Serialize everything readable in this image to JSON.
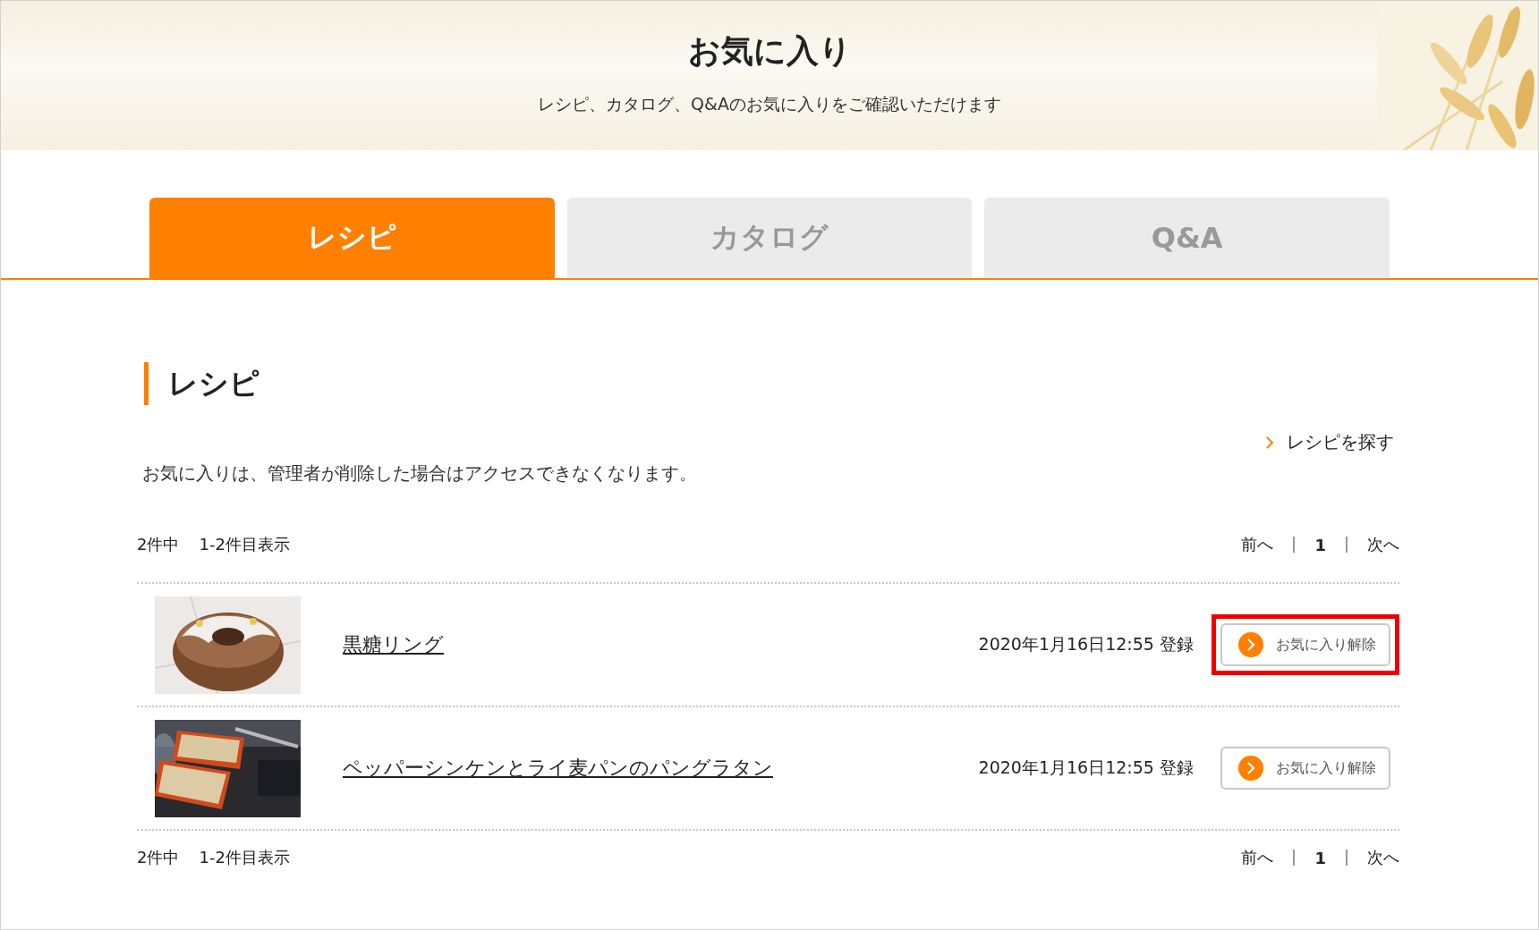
{
  "header": {
    "title": "お気に入り",
    "subtitle": "レシピ、カタログ、Q&Aのお気に入りをご確認いただけます"
  },
  "tabs": [
    {
      "label": "レシピ",
      "selected": true
    },
    {
      "label": "カタログ",
      "selected": false
    },
    {
      "label": "Q&A",
      "selected": false
    }
  ],
  "section": {
    "heading": "レシピ",
    "search_link": "レシピを探す",
    "note": "お気に入りは、管理者が削除した場合はアクセスできなくなります。"
  },
  "pagination_top": {
    "count": "2件中",
    "range": "1-2件目表示",
    "prev": "前へ",
    "page": "1",
    "next": "次へ"
  },
  "items": [
    {
      "title": "黒糖リング",
      "date": "2020年1月16日12:55 登録",
      "button": "お気に入り解除",
      "highlighted": true
    },
    {
      "title": "ペッパーシンケンとライ麦パンのパングラタン",
      "date": "2020年1月16日12:55 登録",
      "button": "お気に入り解除",
      "highlighted": false
    }
  ],
  "pagination_bottom": {
    "count": "2件中",
    "range": "1-2件目表示",
    "prev": "前へ",
    "page": "1",
    "next": "次へ"
  }
}
